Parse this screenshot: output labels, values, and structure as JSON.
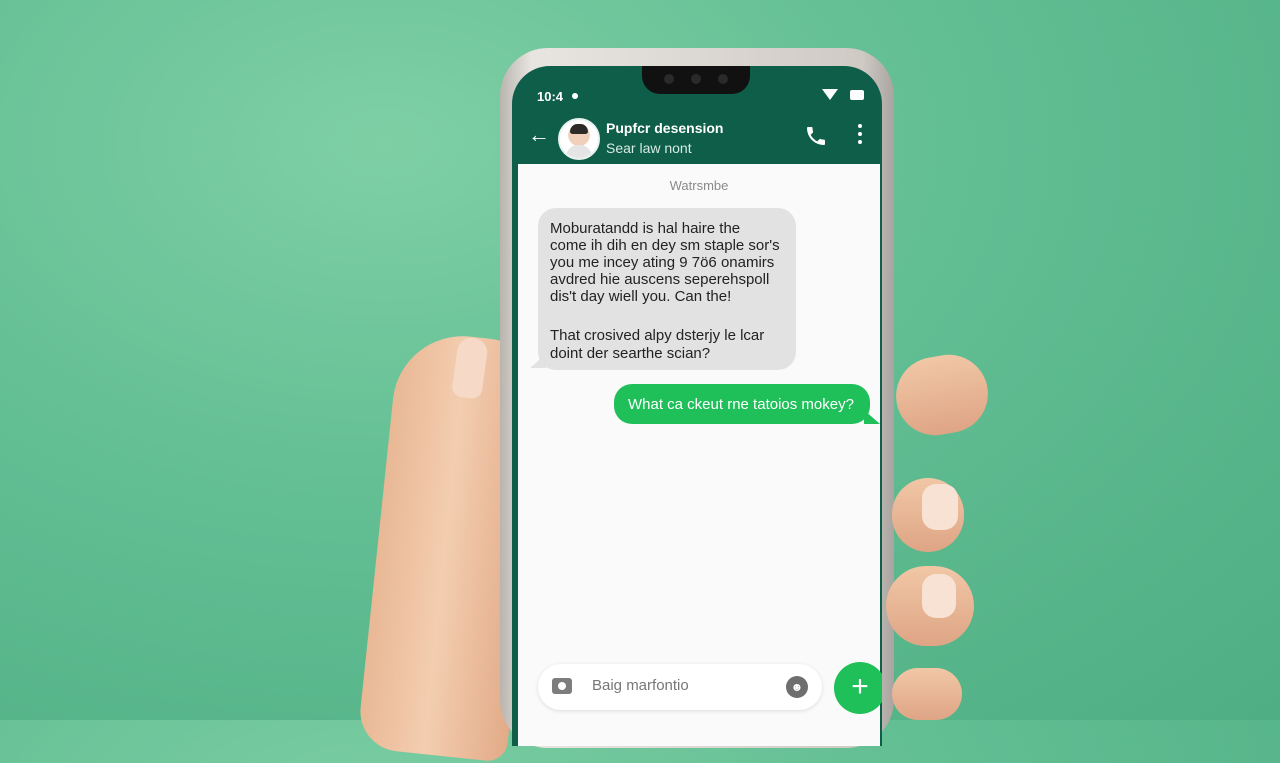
{
  "status_bar": {
    "time": "10:4"
  },
  "header": {
    "contact_name": "Pupfcr desension",
    "contact_status": "Sear law nont"
  },
  "chat": {
    "date_label": "Watrsmbe",
    "incoming": {
      "lines": [
        "Moburatandd is hal haire the",
        "come ih dih en dey sm staple sor's",
        "you me incey ating 9 7ö6 onamirs",
        "avdred hie auscens seperehspoll",
        "dis't day wiell you. Can the!",
        "That crosived alpy dsterjy le lcar",
        "doint der searthe scian?"
      ]
    },
    "outgoing": {
      "text": "What ca ckeut rne tatoios mokey?"
    }
  },
  "composer": {
    "placeholder": "Baig marfontio"
  },
  "colors": {
    "header": "#0f5e49",
    "accent_green": "#1fbf5a",
    "incoming_bubble": "#e2e2e2",
    "background": "#62be93"
  },
  "icons": [
    "back-arrow-icon",
    "phone-icon",
    "more-vertical-icon",
    "camera-icon",
    "sticker-icon",
    "plus-icon"
  ]
}
